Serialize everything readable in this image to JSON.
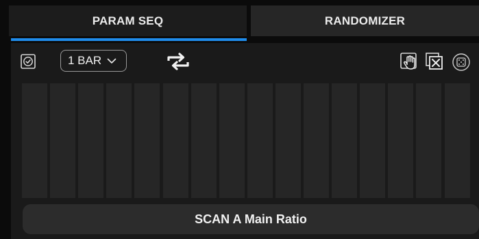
{
  "tabs": [
    {
      "label": "PARAM SEQ",
      "active": true
    },
    {
      "label": "RANDOMIZER",
      "active": false
    }
  ],
  "toolbar": {
    "bar_length": {
      "value": "1 BAR"
    },
    "icons": [
      "check-circle-icon",
      "chevron-down-icon",
      "loop-icon",
      "hand-icon",
      "clear-icon",
      "dice-icon"
    ]
  },
  "steps": {
    "count": 16
  },
  "param_name": "SCAN A Main Ratio",
  "colors": {
    "accent": "#1f8ceb",
    "background": "#0b0b0b",
    "panel": "#1a1a1a",
    "step": "#262626",
    "tab_active": "#1c1c1c",
    "tab_inactive": "#262626",
    "text": "#ececec"
  }
}
